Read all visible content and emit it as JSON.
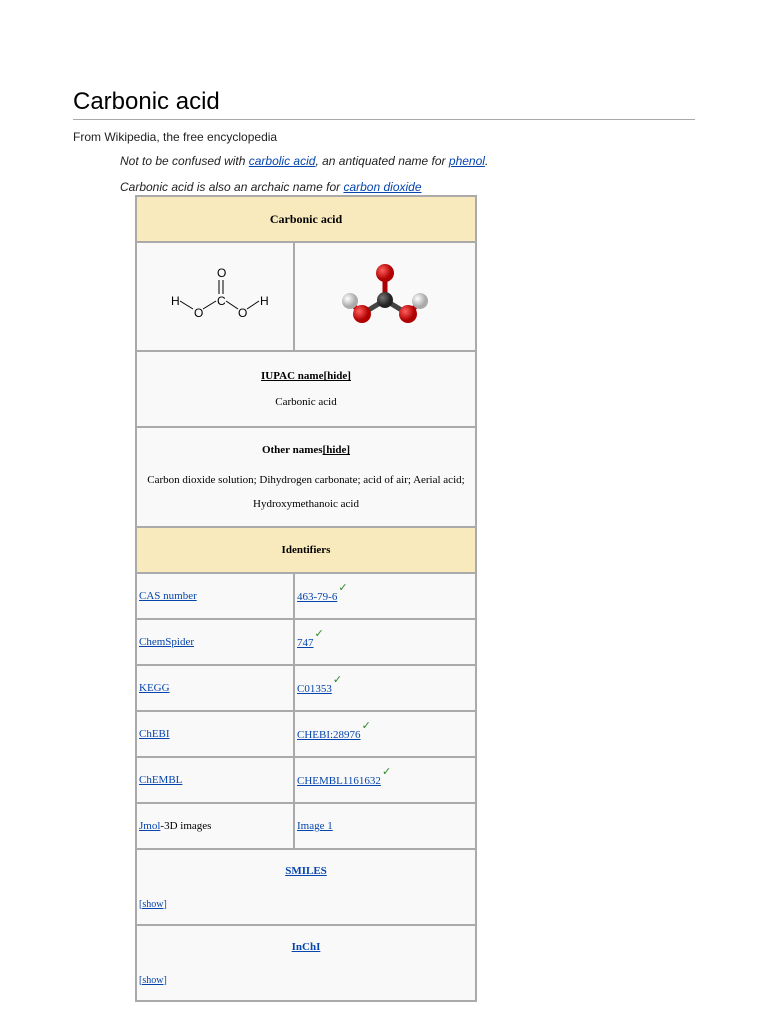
{
  "page": {
    "title": "Carbonic acid",
    "tagline": "From Wikipedia, the free encyclopedia"
  },
  "hatnotes": [
    {
      "prefix": "Not to be confused with ",
      "link1": "carbolic acid",
      "middle": ", an antiquated name for ",
      "link2": "phenol",
      "suffix": "."
    },
    {
      "prefix": "Carbonic acid is also an archaic name for ",
      "link1": "carbon dioxide"
    }
  ],
  "infobox": {
    "title": "Carbonic acid",
    "structure_labels": {
      "o": "O",
      "c": "C",
      "h": "H"
    },
    "iupac_label": "IUPAC name",
    "hide": "[hide]",
    "iupac_value": "Carbonic acid",
    "other_label": "Other names",
    "other_value": "Carbon dioxide solution; Dihydrogen carbonate; acid of air; Aerial acid; Hydroxymethanoic acid",
    "identifiers_label": "Identifiers",
    "check": "✓",
    "ids": [
      {
        "label": "CAS number",
        "value": "463-79-6"
      },
      {
        "label": "ChemSpider",
        "value": "747"
      },
      {
        "label": "KEGG",
        "value": "C01353"
      },
      {
        "label": "ChEBI",
        "value": "CHEBI:28976"
      },
      {
        "label": "ChEMBL",
        "value": "CHEMBL1161632"
      }
    ],
    "jmol_link": "Jmol",
    "jmol_suffix": "-3D images",
    "jmol_value": "Image 1",
    "smiles_label": "SMILES",
    "inchi_label": "InChI",
    "show": "[show]"
  },
  "colors": {
    "link": "#0645ad",
    "header_bg": "#f8eabd",
    "check": "#2a8a2a"
  }
}
